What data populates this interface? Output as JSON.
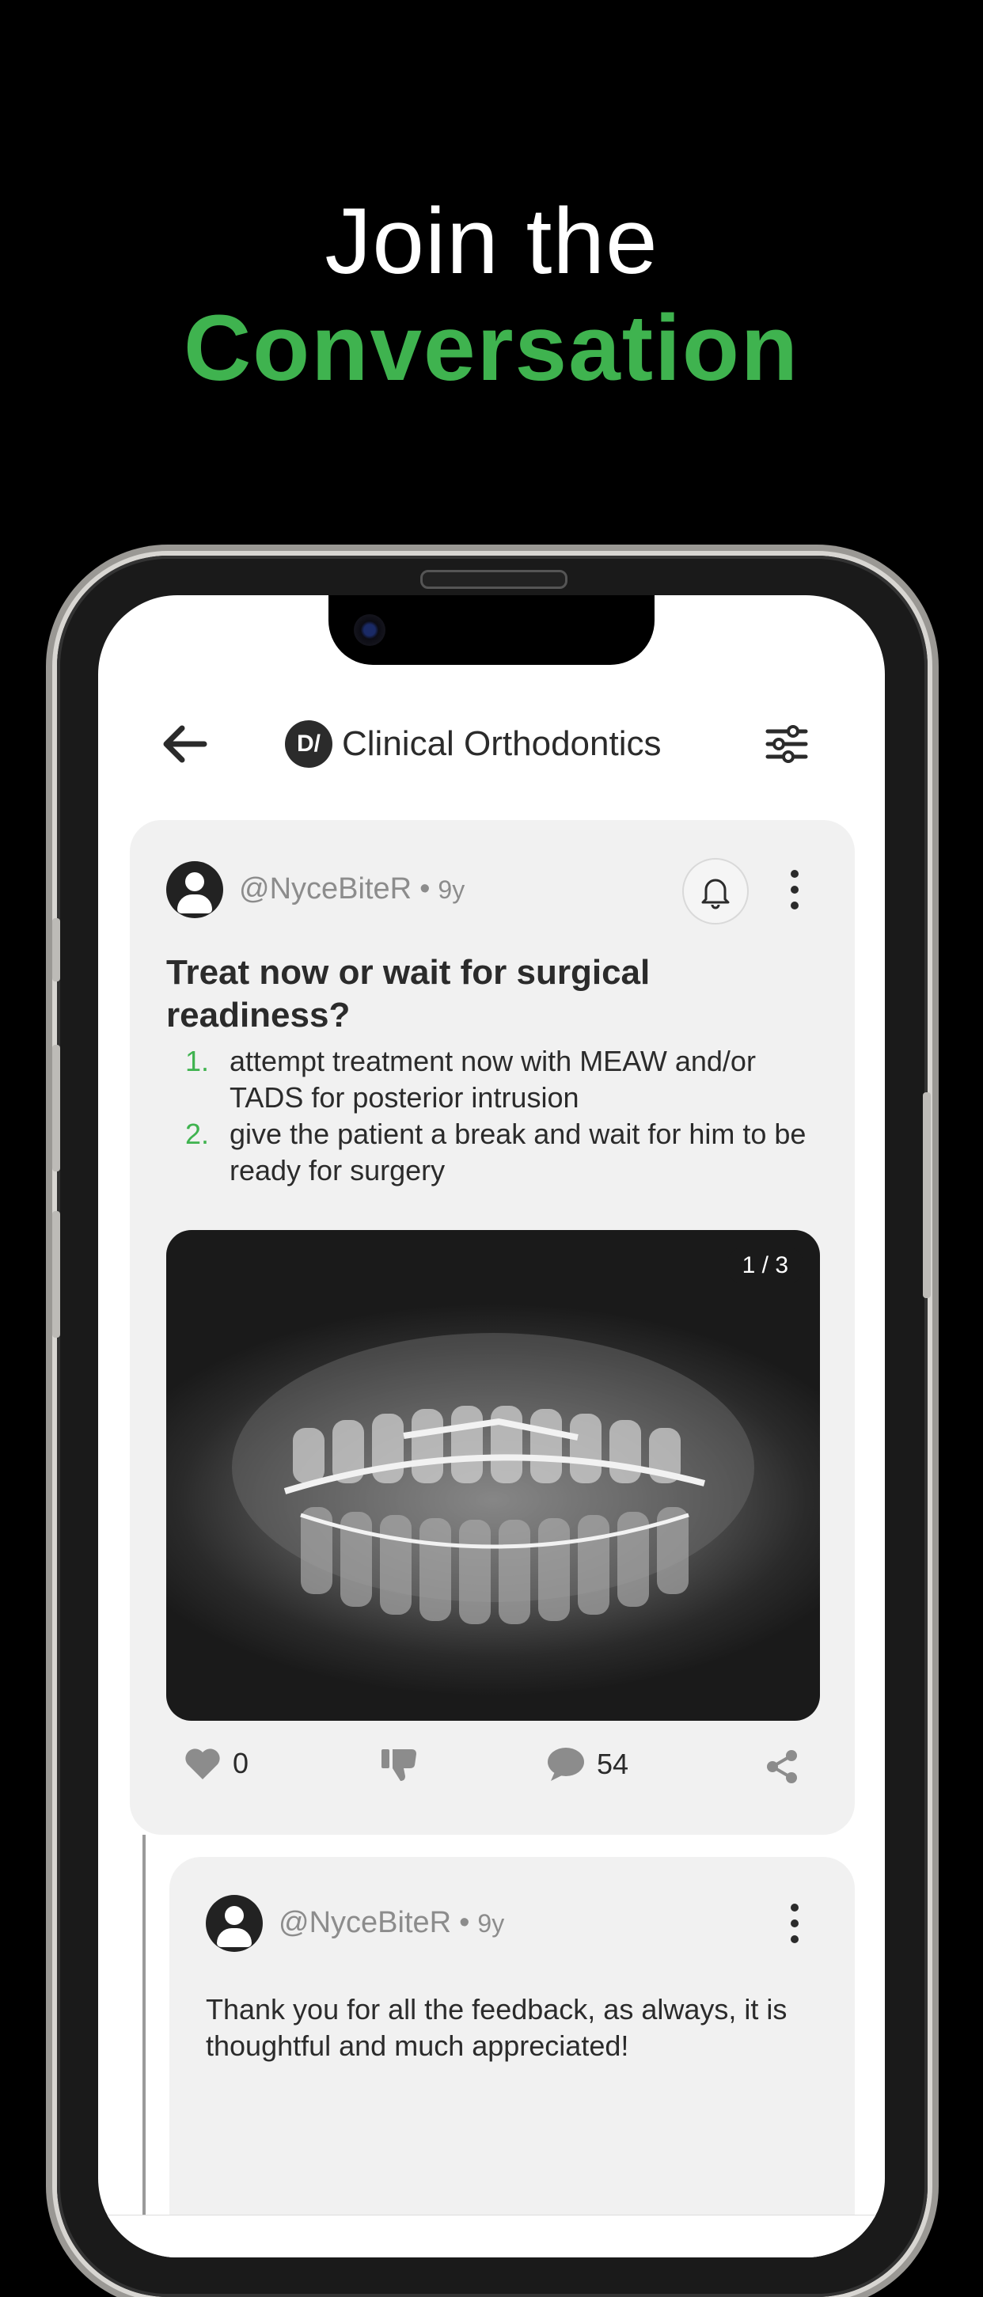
{
  "headline": {
    "line1": "Join the",
    "line2": "Conversation"
  },
  "header": {
    "logo_text": "D/",
    "title": "Clinical Orthodontics"
  },
  "post": {
    "author": "@NyceBiteR",
    "separator": "•",
    "age": "9y",
    "title": "Treat now or wait for surgical readiness?",
    "options": [
      {
        "num": "1.",
        "text": "attempt treatment now with MEAW and/or TADS for posterior intrusion"
      },
      {
        "num": "2.",
        "text": "give the patient a break and wait for him to be ready for surgery"
      }
    ],
    "image_counter": "1 / 3",
    "likes": "0",
    "comments": "54"
  },
  "reply": {
    "author": "@NyceBiteR",
    "separator": "•",
    "age": "9y",
    "text": "Thank you for all the feedback, as always, it is thoughtful and much appreciated!"
  },
  "colors": {
    "accent": "#3fb34f",
    "card": "#f1f1f1",
    "text": "#2b2b2b",
    "muted": "#8c8c8c"
  }
}
